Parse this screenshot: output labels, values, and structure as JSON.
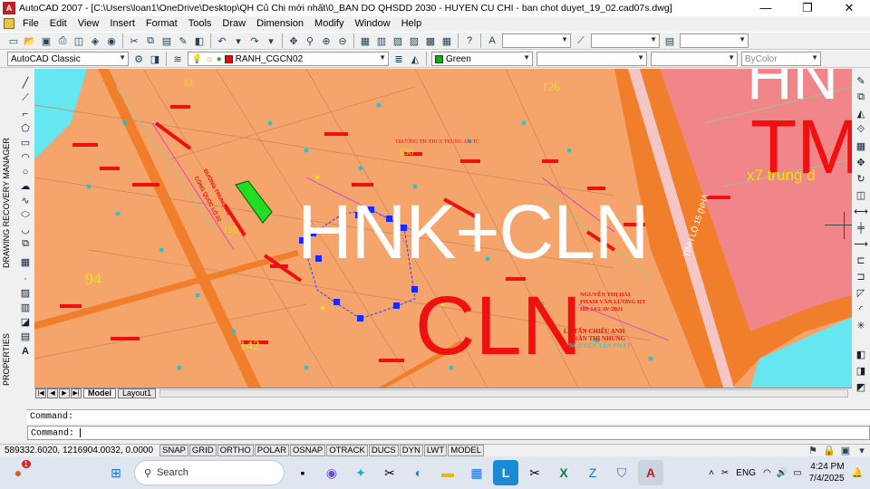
{
  "window": {
    "title": "AutoCAD 2007 - [C:\\Users\\loan1\\OneDrive\\Desktop\\QH Củ Chi mới nhất\\0_BAN DO QHSDD 2030 - HUYEN CU CHI - ban chot duyet_19_02.cad07s.dwg]",
    "minimize": "—",
    "restore": "❐",
    "close": "✕"
  },
  "menu": [
    "File",
    "Edit",
    "View",
    "Insert",
    "Format",
    "Tools",
    "Draw",
    "Dimension",
    "Modify",
    "Window",
    "Help"
  ],
  "toolbar2": {
    "workspace": "AutoCAD Classic",
    "layer": "RANH_CGCN02",
    "color": "Green",
    "color_hex": "#00b000",
    "linetype": "",
    "lineweight": "",
    "plotstyle": "ByColor"
  },
  "left_panel": {
    "recovery_label": "DRAWING RECOVERY MANAGER",
    "properties_label": "PROPERTIES"
  },
  "drawing": {
    "labels": {
      "hnk_cln": "HNK+CLN",
      "cln": "CLN",
      "tm": "TM",
      "hn_top": "HN",
      "tinh_lo": "TỈNH LỘ 15 (NHÀ",
      "trung": "x7 trung d",
      "parcel_94": "94",
      "parcel_142": "142",
      "parcel_130": "130",
      "parcel_158": "158",
      "parcel_33": "33",
      "parcel_126": "126",
      "owner_1": "NGUYỄN THỊ HẢI",
      "owner_2": "PHẠM VĂN LƯƠNG HT",
      "owner_3": "HĐ 14/2 AV/2021",
      "owner_4": "LÊ TẤN CHIẾU ANH",
      "owner_5": "TRẦN THỊ NHUNG",
      "owner_6": "NGUYỄN TẤN PHÁT",
      "school": "TRƯỜNG TH-THCS TRUNG AN TC",
      "road_left": "ĐƯỜNG TRUNG AN",
      "road_left2": "CÔNG QUỐC LỘ 22"
    }
  },
  "tabs": {
    "model": "Model",
    "layout1": "Layout1"
  },
  "command": {
    "history": "Command:",
    "prompt": "Command:"
  },
  "status": {
    "coords": "589332.6020, 1216904.0032, 0.0000",
    "toggles": [
      "SNAP",
      "GRID",
      "ORTHO",
      "POLAR",
      "OSNAP",
      "OTRACK",
      "DUCS",
      "DYN",
      "LWT",
      "MODEL"
    ]
  },
  "taskbar": {
    "search_placeholder": "Search",
    "lang": "ENG",
    "time": "4:24 PM",
    "date": "7/4/2025",
    "notification_badge": "1"
  }
}
